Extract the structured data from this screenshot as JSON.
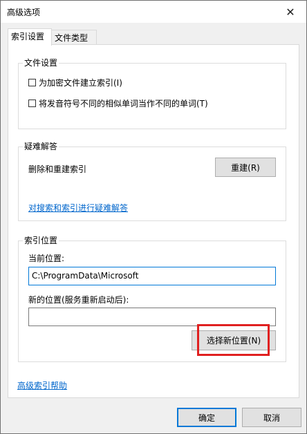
{
  "window": {
    "title": "高级选项",
    "close_glyph": "✕"
  },
  "tabs": [
    {
      "label": "索引设置",
      "active": true
    },
    {
      "label": "文件类型",
      "active": false
    }
  ],
  "file_settings": {
    "title": "文件设置",
    "options": [
      {
        "label": "为加密文件建立索引(I)",
        "checked": false
      },
      {
        "label": "将发音符号不同的相似单词当作不同的单词(T)",
        "checked": false
      }
    ]
  },
  "troubleshooting": {
    "title": "疑难解答",
    "rebuild_text": "删除和重建索引",
    "rebuild_button": "重建(R)",
    "link": "对搜索和索引进行疑难解答"
  },
  "index_location": {
    "title": "索引位置",
    "current_label": "当前位置:",
    "current_value": "C:\\ProgramData\\Microsoft",
    "new_label": "新的位置(服务重新启动后):",
    "new_value": "",
    "select_button": "选择新位置(N)"
  },
  "footer": {
    "help_link": "高级索引帮助",
    "ok_button": "确定",
    "cancel_button": "取消"
  },
  "colors": {
    "accent": "#0078d7",
    "link": "#0066cc",
    "highlight": "#e02020"
  }
}
